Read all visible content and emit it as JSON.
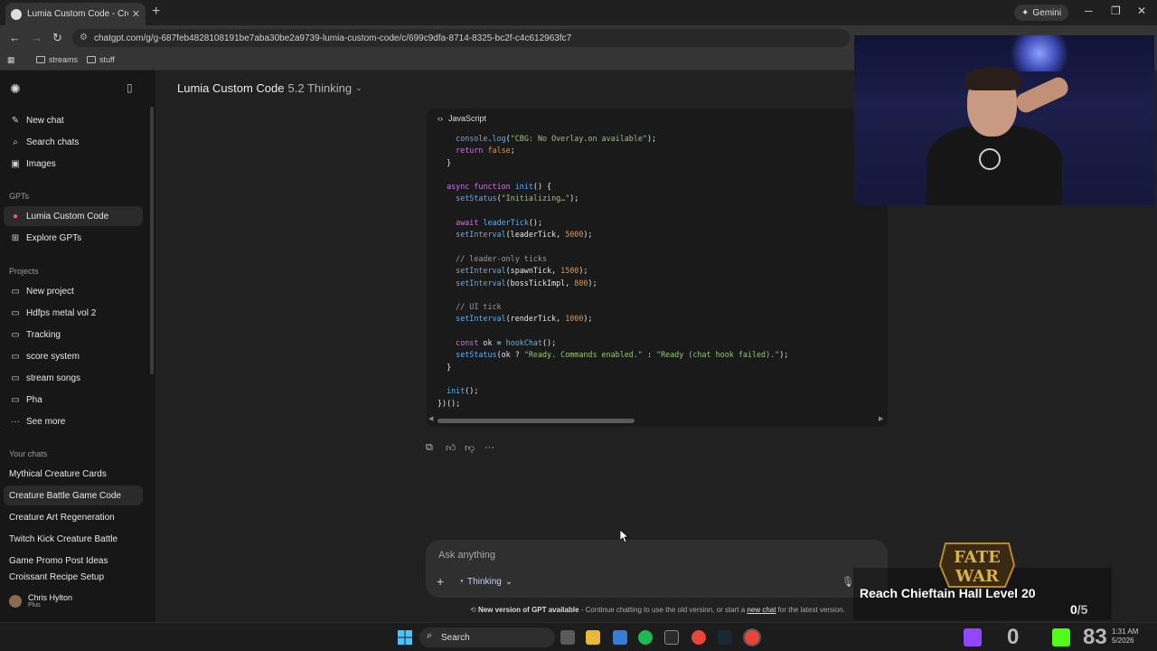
{
  "browser": {
    "tab_title": "Lumia Custom Code - Creature",
    "url": "chatgpt.com/g/g-687feb4828108191be7aba30be2a9739-lumia-custom-code/c/699c9dfa-8714-8325-bc2f-c4c612963fc7",
    "gemini_label": "Gemini",
    "bookmarks": [
      "streams",
      "stuff"
    ]
  },
  "sidebar": {
    "top_items": [
      {
        "label": "New chat",
        "icon": "edit-icon"
      },
      {
        "label": "Search chats",
        "icon": "search-icon"
      },
      {
        "label": "Images",
        "icon": "image-icon"
      }
    ],
    "gpts_heading": "GPTs",
    "gpts": [
      {
        "label": "Lumia Custom Code",
        "active": true
      },
      {
        "label": "Explore GPTs"
      }
    ],
    "projects_heading": "Projects",
    "projects": [
      "New project",
      "Hdfps metal vol 2",
      "Tracking",
      "score system",
      "stream songs",
      "Pha",
      "See more"
    ],
    "chats_heading": "Your chats",
    "chats": [
      "Mythical Creature Cards",
      "Creature Battle Game Code",
      "Creature Art Regeneration",
      "Twitch Kick Creature Battle",
      "Game Promo Post Ideas",
      "Croissant Recipe Setup"
    ],
    "user": {
      "name": "Chris Hylton",
      "plan": "Plus"
    }
  },
  "header": {
    "title": "Lumia Custom Code",
    "model": "5.2 Thinking"
  },
  "code": {
    "language": "JavaScript"
  },
  "composer": {
    "placeholder": "Ask anything",
    "mode": "Thinking"
  },
  "notice": {
    "bold": "New version of GPT available",
    "text": " - Continue chatting to use the old version, or start a ",
    "link": "new chat",
    "tail": " for the latest version."
  },
  "overlay": {
    "game_title_top": "FATE",
    "game_title_bottom": "WAR",
    "goal": "Reach Chieftain Hall Level 20",
    "goal_progress": "0",
    "goal_total": "/5",
    "twitch_count": "0",
    "kick_count": "83"
  },
  "taskbar": {
    "search": "Search",
    "time": "1:31 AM",
    "date": "5/2026"
  },
  "colors": {
    "sidebar_bg": "#171717",
    "main_bg": "#212121",
    "code_bg": "#1a1a1a",
    "keyword": "#c678dd",
    "function": "#61afef",
    "string": "#98c379",
    "number": "#d19a66"
  }
}
